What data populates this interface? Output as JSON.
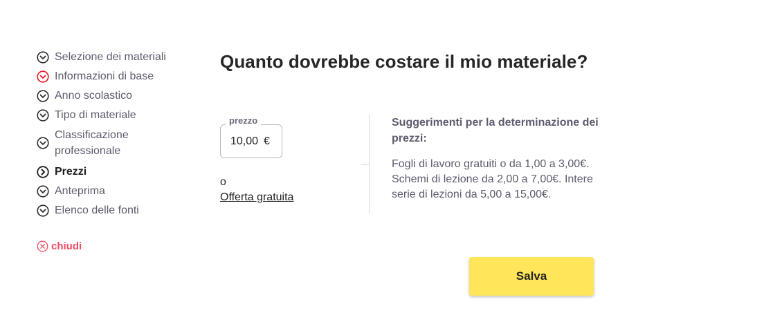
{
  "sidebar": {
    "items": [
      {
        "label": "Selezione dei materiali",
        "state": "done"
      },
      {
        "label": "Informazioni di base",
        "state": "error"
      },
      {
        "label": "Anno scolastico",
        "state": "done"
      },
      {
        "label": "Tipo di materiale",
        "state": "done"
      },
      {
        "label": "Classificazione professionale",
        "state": "done"
      },
      {
        "label": "Prezzi",
        "state": "active"
      },
      {
        "label": "Anteprima",
        "state": "done"
      },
      {
        "label": "Elenco delle fonti",
        "state": "done"
      }
    ],
    "close_label": "chiudi"
  },
  "main": {
    "title": "Quanto dovrebbe costare il mio materiale?",
    "price": {
      "label": "prezzo",
      "value": "10,00",
      "currency": "€"
    },
    "or_text": "o",
    "free_offer_label": "Offerta gratuita",
    "tips": {
      "heading": "Suggerimenti per la determinazione dei prezzi:",
      "body": "Fogli di lavoro gratuiti o da 1,00 a 3,00€. Schemi di lezione da 2,00 a 7,00€. Intere serie di lezioni da 5,00 a 15,00€."
    },
    "save_label": "Salva"
  },
  "colors": {
    "accent_yellow": "#ffe55a",
    "error_red": "#e8141e",
    "close_red": "#f04b62",
    "muted_text": "#5c5c6e"
  }
}
